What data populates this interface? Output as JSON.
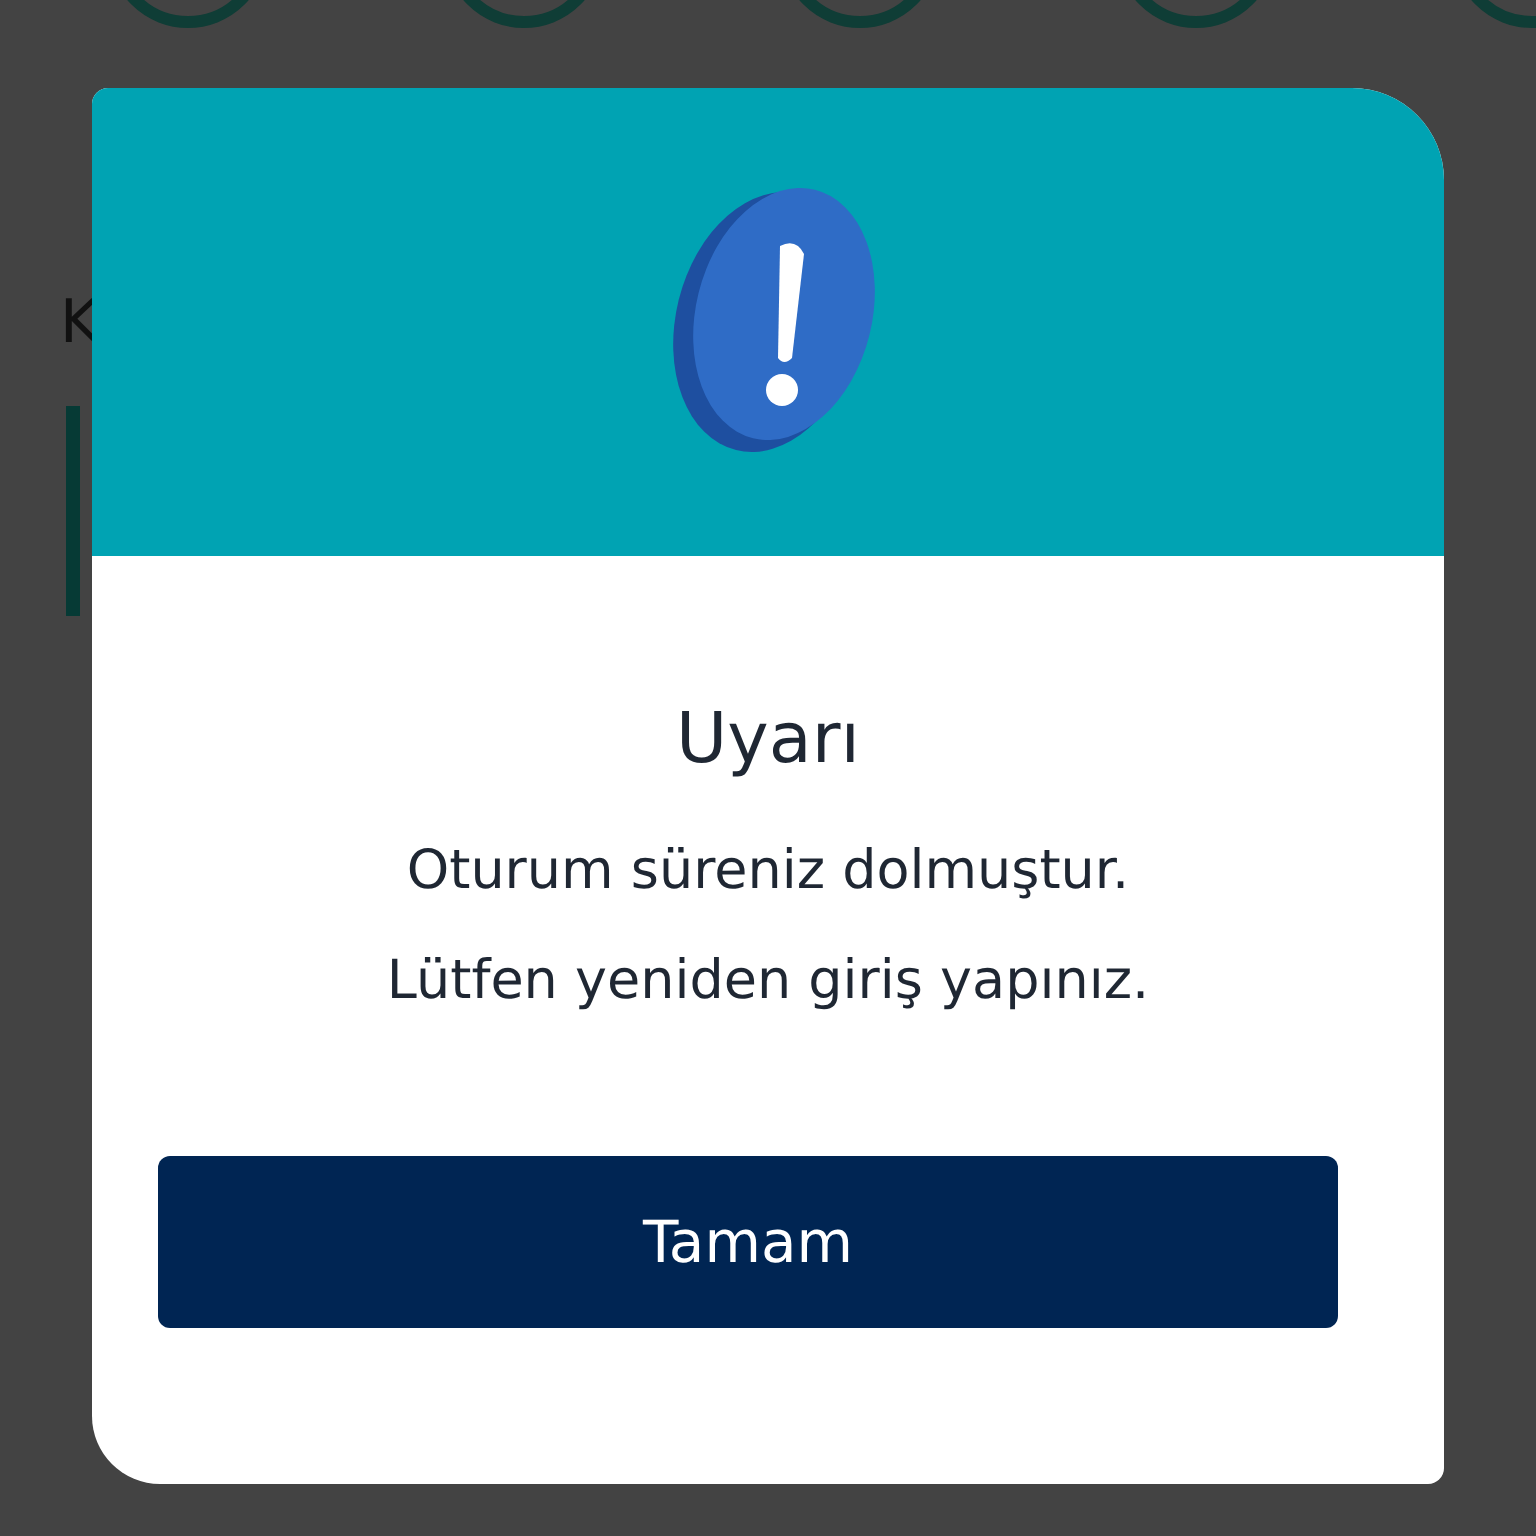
{
  "background": {
    "section_title": "K"
  },
  "dialog": {
    "title": "Uyarı",
    "message_lines": [
      "Oturum süreniz dolmuştur.",
      "Lütfen yeniden giriş yapınız."
    ],
    "button": "Tamam"
  }
}
